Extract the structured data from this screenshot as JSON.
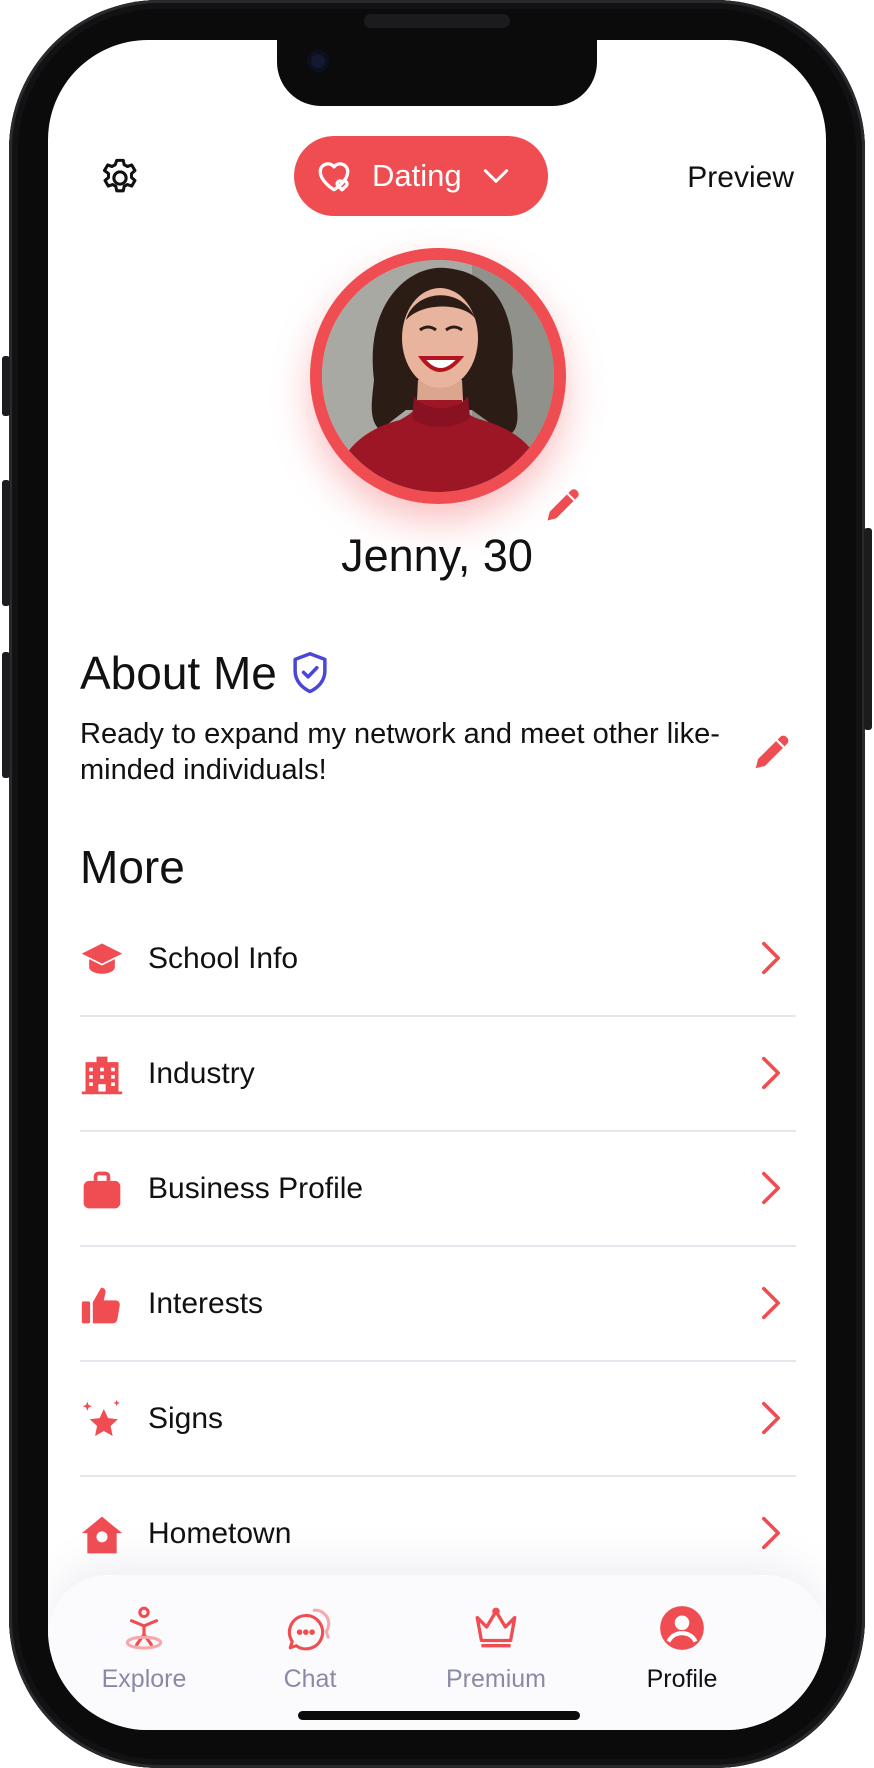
{
  "header": {
    "settings_icon": "gear-icon",
    "mode": {
      "label": "Dating",
      "icon": "hearts-icon",
      "dropdown_icon": "chevron-down-icon"
    },
    "preview_label": "Preview"
  },
  "profile": {
    "name": "Jenny, 30",
    "avatar_icon": "profile-photo",
    "edit_icon": "pencil-icon"
  },
  "about": {
    "title": "About Me",
    "verified_icon": "shield-check-icon",
    "text": "Ready to expand my network and meet other like-minded individuals!"
  },
  "more": {
    "title": "More",
    "items": [
      {
        "label": "School Info",
        "icon": "graduation-cap-icon"
      },
      {
        "label": "Industry",
        "icon": "building-icon"
      },
      {
        "label": "Business Profile",
        "icon": "briefcase-icon"
      },
      {
        "label": "Interests",
        "icon": "thumbs-up-icon"
      },
      {
        "label": "Signs",
        "icon": "sparkle-star-icon"
      },
      {
        "label": "Hometown",
        "icon": "home-icon"
      }
    ]
  },
  "tabbar": {
    "tabs": [
      {
        "label": "Explore",
        "icon": "explore-icon",
        "active": false
      },
      {
        "label": "Chat",
        "icon": "chat-bubbles-icon",
        "active": false
      },
      {
        "label": "Premium",
        "icon": "crown-icon",
        "active": false
      },
      {
        "label": "Profile",
        "icon": "user-circle-icon",
        "active": true
      }
    ]
  },
  "colors": {
    "accent": "#f04d52",
    "verified": "#4b47d6",
    "inactive": "#8a8aa8",
    "text": "#111111"
  }
}
